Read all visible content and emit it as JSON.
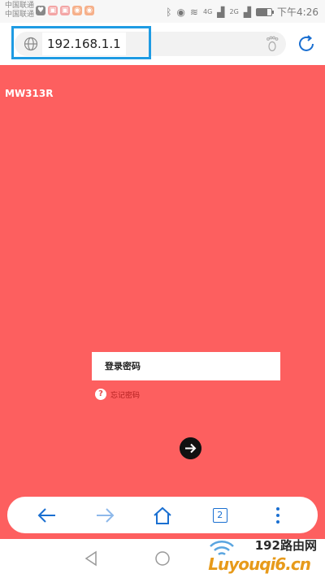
{
  "status_bar": {
    "carrier_1": "中国联通",
    "carrier_2": "中国联通",
    "time": "下午4:26",
    "signal_1": "4G",
    "signal_2": "2G",
    "battery_level": 0.7
  },
  "browser": {
    "url": "192.168.1.1"
  },
  "page": {
    "model": "MW313R",
    "password_placeholder": "登录密码",
    "forgot_password": "忘记密码",
    "accent": "#fd5f5f"
  },
  "toolbar": {
    "tab_count": "2"
  },
  "watermark": {
    "line1": "192路由网",
    "line2": "Luyouqi6.cn"
  }
}
